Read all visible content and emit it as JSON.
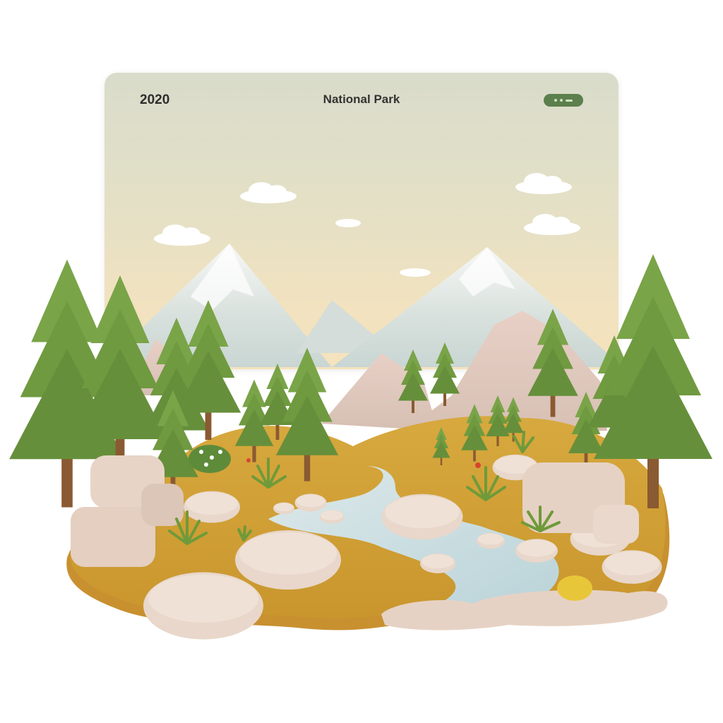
{
  "card": {
    "year": "2020",
    "title": "National Park",
    "pill_icon": "toggle-dots-icon"
  },
  "colors": {
    "sky_top": "#d9dccb",
    "sky_bottom": "#f5e3bd",
    "pill": "#5c7f4e",
    "grass": "#d6a83a",
    "tree": "#6f9a40",
    "rock": "#e6d4c6",
    "water": "#cfe3e6"
  }
}
